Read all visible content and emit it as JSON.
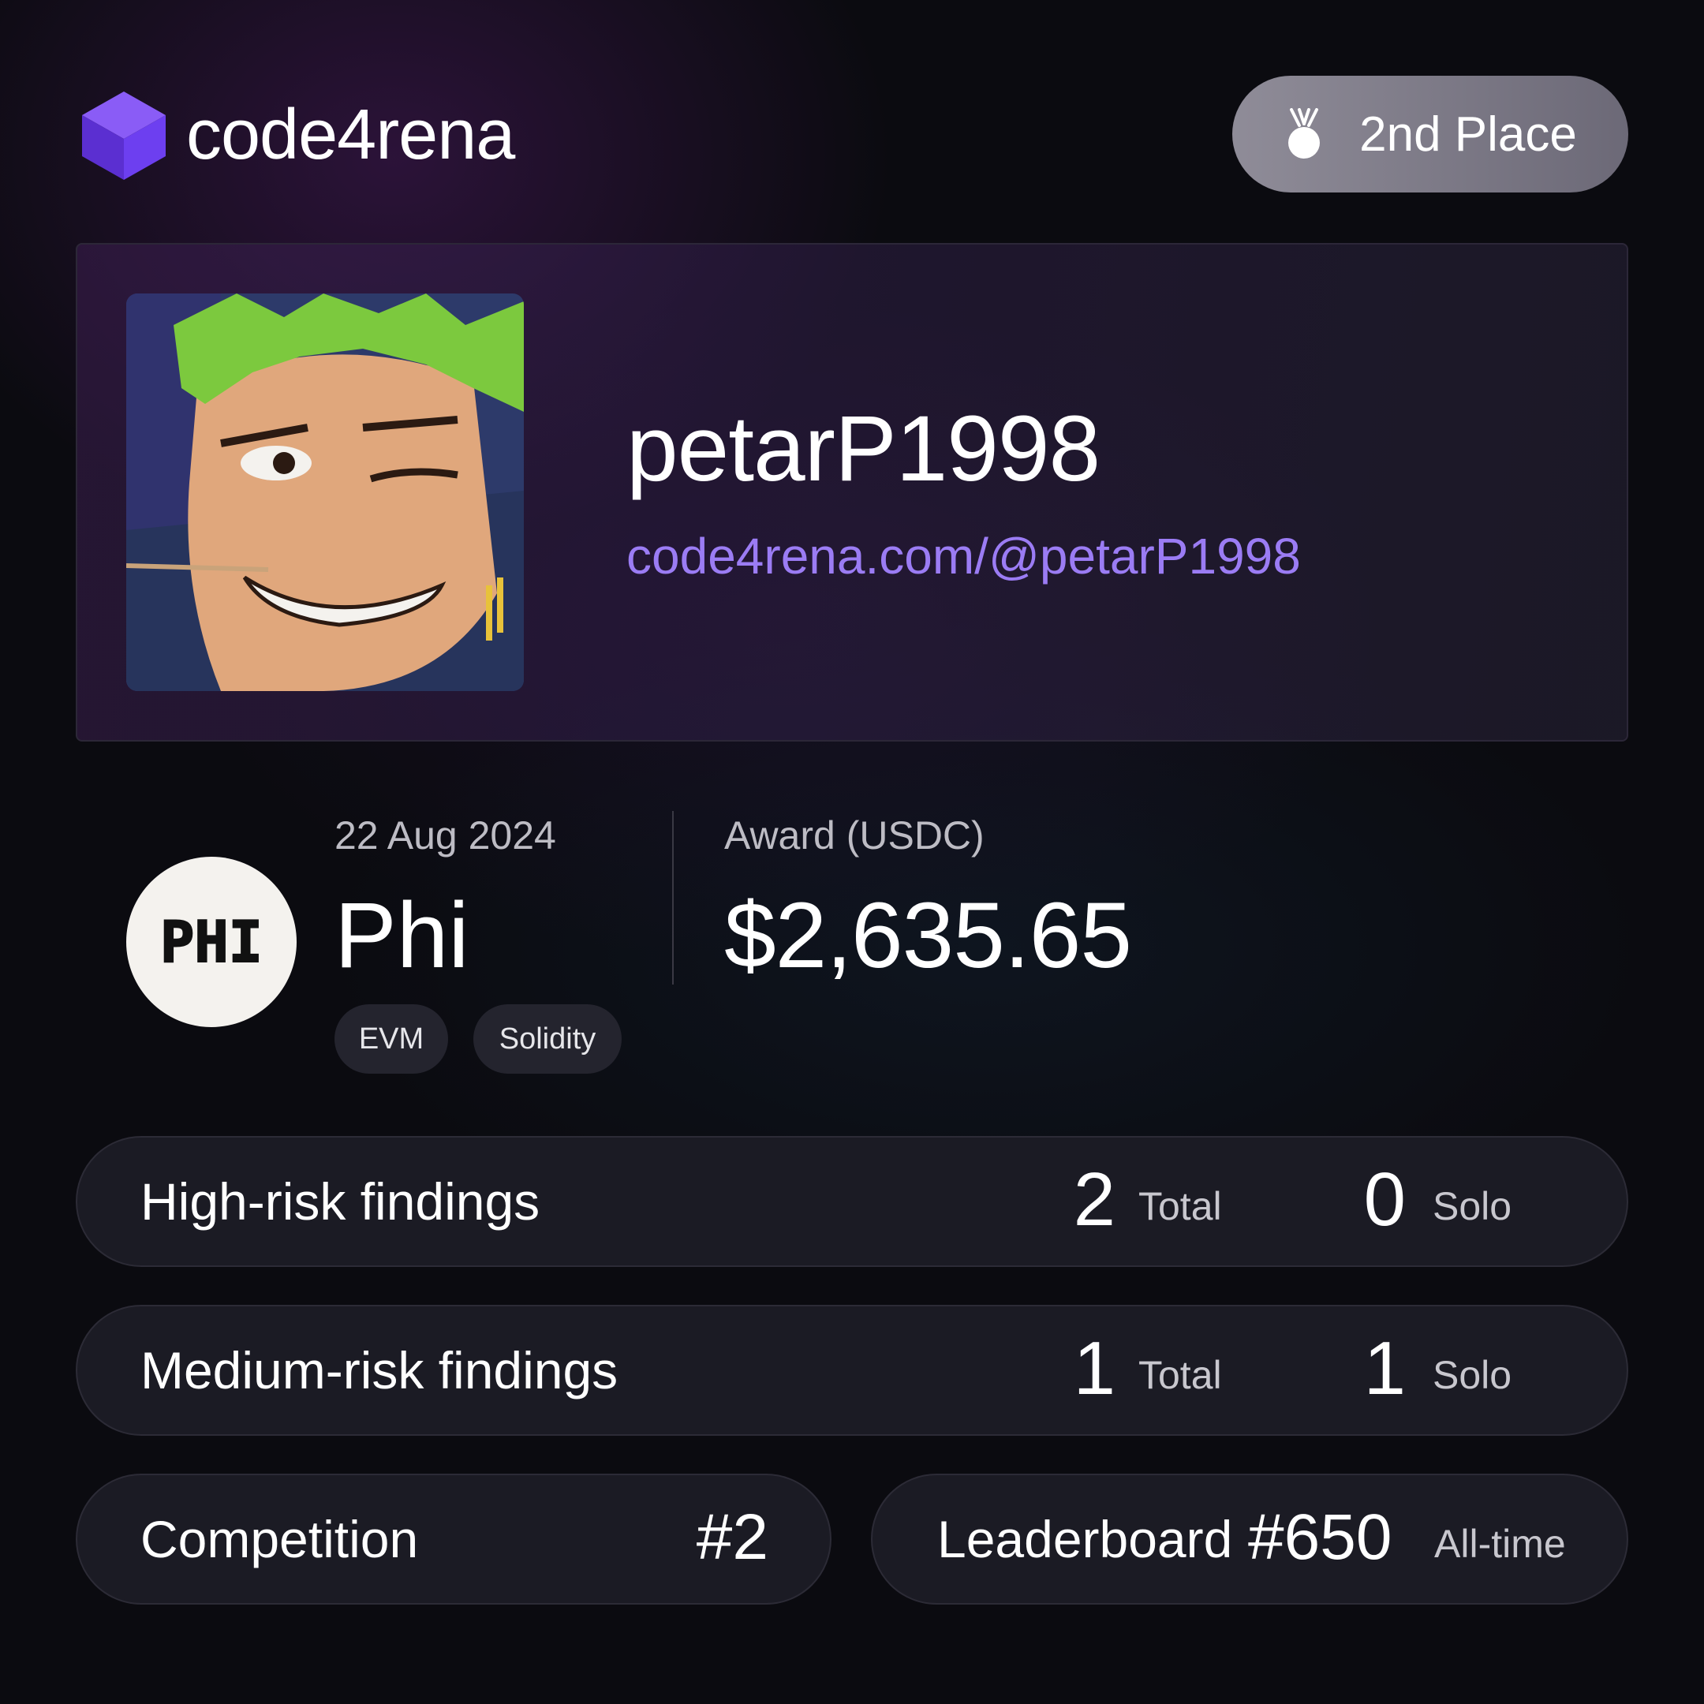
{
  "brand": {
    "name": "code4rena",
    "logo_icon": "cube-logo-icon"
  },
  "placement": {
    "label": "2nd Place",
    "icon": "medal-icon"
  },
  "profile": {
    "username": "petarP1998",
    "url": "code4rena.com/@petarP1998",
    "url_color": "#9b7cf4"
  },
  "contest": {
    "date": "22 Aug 2024",
    "name": "Phi",
    "sponsor_logo_text": "PHI",
    "tags": [
      "EVM",
      "Solidity"
    ],
    "award_label": "Award (USDC)",
    "award_value": "$2,635.65"
  },
  "findings": {
    "high": {
      "label": "High-risk findings",
      "total": "2",
      "total_label": "Total",
      "solo": "0",
      "solo_label": "Solo"
    },
    "medium": {
      "label": "Medium-risk findings",
      "total": "1",
      "total_label": "Total",
      "solo": "1",
      "solo_label": "Solo"
    }
  },
  "competition": {
    "label": "Competition",
    "rank": "#2"
  },
  "leaderboard": {
    "label": "Leaderboard",
    "rank": "#650",
    "scope": "All-time"
  }
}
